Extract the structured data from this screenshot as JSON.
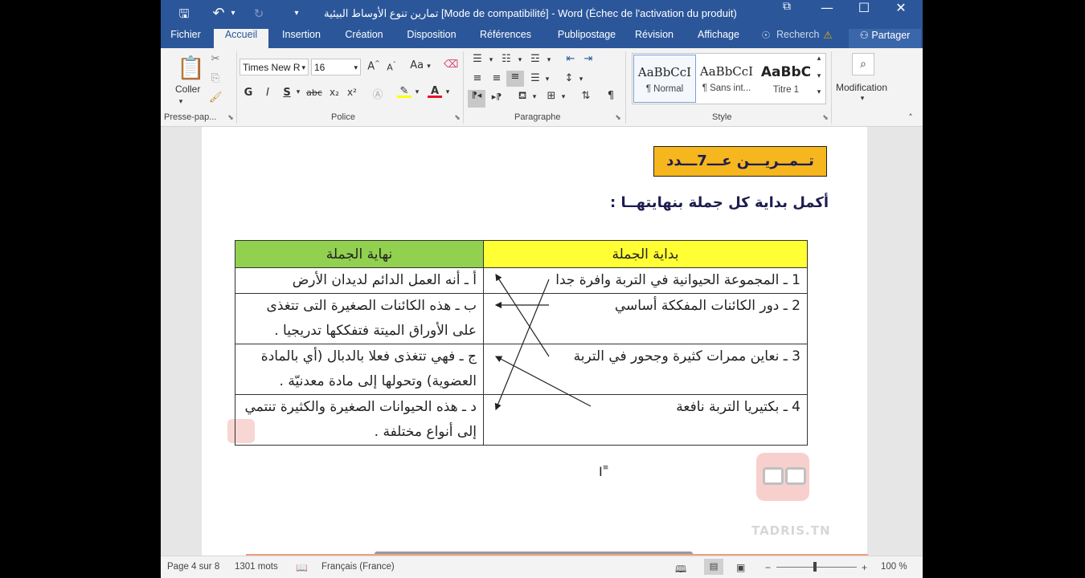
{
  "window": {
    "title": "تمارين تنوع الأوساط البيئية [Mode de compatibilité] - Word (Échec de l'activation du produit)",
    "controls": {
      "ribbon_display": "⧉",
      "minimize": "—",
      "maximize": "☐",
      "close": "✕"
    }
  },
  "quick_access": {
    "save": "🖫",
    "undo": "↶",
    "undo_arrow": "▾",
    "redo": "↻",
    "customize": "▾"
  },
  "tabs": [
    "Fichier",
    "Accueil",
    "Insertion",
    "Création",
    "Disposition",
    "Références",
    "Publipostage",
    "Révision",
    "Affichage"
  ],
  "active_tab": "Accueil",
  "tell_me": "Recherch",
  "share": "Partager",
  "ribbon": {
    "clipboard": {
      "label": "Presse-pap...",
      "paste": "Coller"
    },
    "font": {
      "label": "Police",
      "family": "Times New R",
      "size": "16",
      "grow": "A",
      "shrink": "A",
      "case": "Aa",
      "bold": "G",
      "italic": "I",
      "underline": "S",
      "strike": "abc",
      "subscript": "x₂",
      "superscript": "x²",
      "highlight_color": "#ffff00",
      "font_color": "#e81123"
    },
    "paragraph": {
      "label": "Paragraphe",
      "pilcrow": "¶"
    },
    "styles": {
      "label": "Style",
      "items": [
        {
          "preview": "AaBbCcI",
          "name": "¶ Normal"
        },
        {
          "preview": "AaBbCcI",
          "name": "¶ Sans int..."
        },
        {
          "preview": "AaBbC",
          "name": "Titre 1"
        }
      ]
    },
    "editing": {
      "label": "Modification"
    }
  },
  "document": {
    "exercise_title": "تــمــريـــن عـــ7ـــدد",
    "instruction": "أكمل بداية كل جملة بنهايتهــا :",
    "table": {
      "header_start": "بداية الجملة",
      "header_end": "نهاية الجملة",
      "header_start_color": "#ffff33",
      "header_end_color": "#92d050",
      "rows": [
        {
          "start": "1 ـ المجموعة الحيوانية في التربة وافرة جدا",
          "end": "أ ـ أنه العمل الدائم لديدان الأرض"
        },
        {
          "start": "2 ـ دور الكائنات المفككة أساسي",
          "end": "ب ـ هذه الكائنات الصغيرة التى تتغذى على الأوراق الميتة فتفككها تدريجيا ."
        },
        {
          "start": "3 ـ نعاين ممرات كثيرة وجحور في التربة",
          "end": "ج ـ فهي تتغذى فعلا بالدبال (أي بالمادة العضوية) وتحولها إلى مادة معدنيّة ."
        },
        {
          "start": "4 ـ بكتيريا التربة نافعة",
          "end": "د ـ هذه الحيوانات الصغيرة والكثيرة تنتمي إلى أنواع مختلفة ."
        }
      ]
    },
    "watermark": "TADRIS.TN"
  },
  "status": {
    "page": "Page 4 sur 8",
    "words": "1301 mots",
    "language": "Français (France)",
    "zoom": "100 %"
  }
}
